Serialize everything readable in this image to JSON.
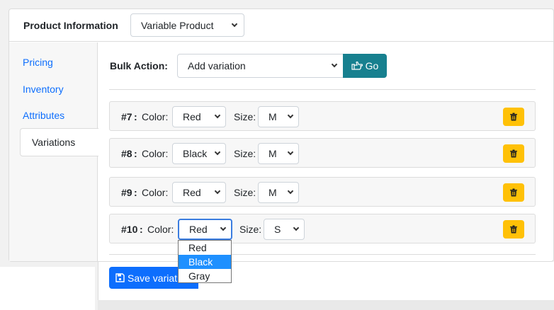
{
  "header": {
    "title": "Product Information",
    "product_type": "Variable Product"
  },
  "sidebar": {
    "items": [
      {
        "label": "Pricing"
      },
      {
        "label": "Inventory"
      },
      {
        "label": "Attributes"
      },
      {
        "label": "Variations"
      }
    ],
    "active": "Variations"
  },
  "bulk": {
    "label": "Bulk Action:",
    "selected": "Add variation",
    "go_label": "Go"
  },
  "variations": [
    {
      "num": "#7",
      "color_label": "Color:",
      "color": "Red",
      "size_label": "Size:",
      "size": "M"
    },
    {
      "num": "#8",
      "color_label": "Color:",
      "color": "Black",
      "size_label": "Size:",
      "size": "M"
    },
    {
      "num": "#9",
      "color_label": "Color:",
      "color": "Red",
      "size_label": "Size:",
      "size": "M"
    },
    {
      "num": "#10",
      "color_label": "Color:",
      "color": "Red",
      "size_label": "Size:",
      "size": "S"
    }
  ],
  "color_dropdown": {
    "options": [
      "Red",
      "Black",
      "Gray"
    ],
    "highlighted": "Black"
  },
  "save": {
    "label": "Save variations"
  },
  "colors": {
    "primary": "#0d6efd",
    "go": "#17808f",
    "trash": "#ffc107",
    "highlight": "#1e90ff"
  },
  "icons": {
    "go": "hand-point-right-icon",
    "trash": "trash-icon",
    "save": "floppy-disk-icon"
  }
}
